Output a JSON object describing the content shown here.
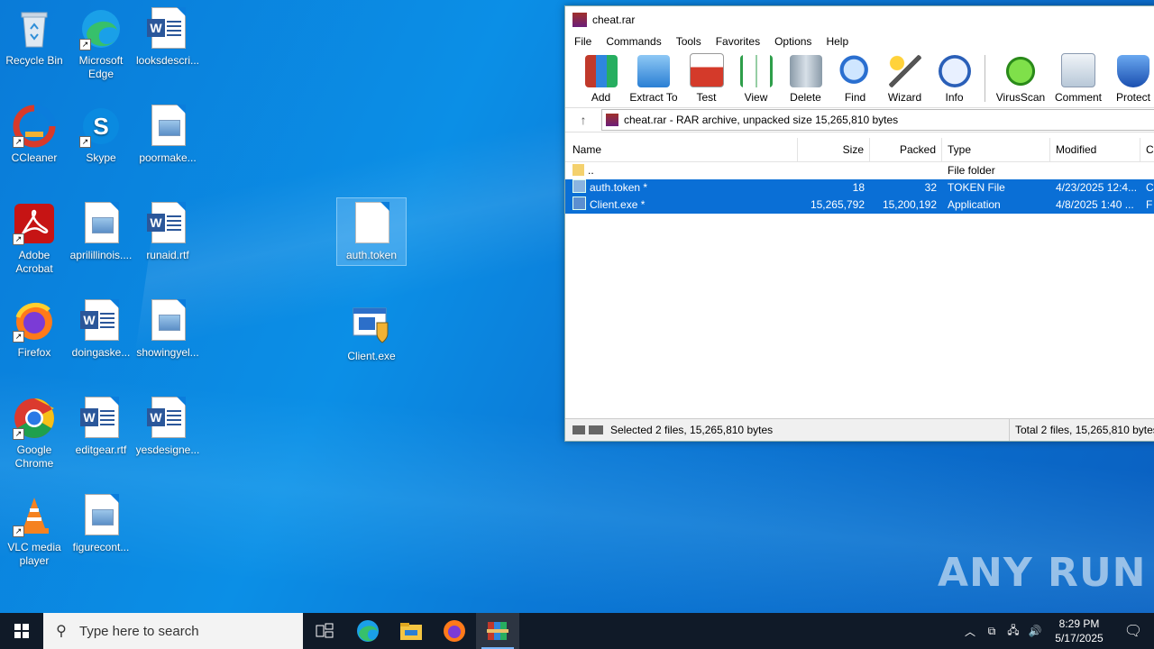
{
  "desktop": {
    "icons": [
      {
        "label": "Recycle Bin"
      },
      {
        "label": "Microsoft Edge"
      },
      {
        "label": "looksdescri..."
      },
      {
        "label": "CCleaner"
      },
      {
        "label": "Skype"
      },
      {
        "label": "poormake..."
      },
      {
        "label": "Adobe Acrobat"
      },
      {
        "label": "aprilillinois...."
      },
      {
        "label": "runaid.rtf"
      },
      {
        "label": "auth.token"
      },
      {
        "label": "Firefox"
      },
      {
        "label": "doingaske..."
      },
      {
        "label": "showingyel..."
      },
      {
        "label": "Client.exe"
      },
      {
        "label": "Google Chrome"
      },
      {
        "label": "editgear.rtf"
      },
      {
        "label": "yesdesigne..."
      },
      {
        "label": "VLC media player"
      },
      {
        "label": "figurecont..."
      }
    ]
  },
  "winrar": {
    "title": "cheat.rar",
    "menu": [
      "File",
      "Commands",
      "Tools",
      "Favorites",
      "Options",
      "Help"
    ],
    "toolbar": [
      "Add",
      "Extract To",
      "Test",
      "View",
      "Delete",
      "Find",
      "Wizard",
      "Info",
      "VirusScan",
      "Comment",
      "Protect"
    ],
    "address": "cheat.rar - RAR archive, unpacked size 15,265,810 bytes",
    "columns": {
      "name": "Name",
      "size": "Size",
      "packed": "Packed",
      "type": "Type",
      "modified": "Modified",
      "c": "C"
    },
    "rows": [
      {
        "name": "..",
        "size": "",
        "packed": "",
        "type": "File folder",
        "modified": "",
        "c": ""
      },
      {
        "name": "auth.token *",
        "size": "18",
        "packed": "32",
        "type": "TOKEN File",
        "modified": "4/23/2025 12:4...",
        "c": "C"
      },
      {
        "name": "Client.exe *",
        "size": "15,265,792",
        "packed": "15,200,192",
        "type": "Application",
        "modified": "4/8/2025 1:40 ...",
        "c": "F"
      }
    ],
    "status_left": "Selected 2 files, 15,265,810 bytes",
    "status_right": "Total 2 files, 15,265,810 bytes"
  },
  "watermark": "ANY RUN",
  "taskbar": {
    "search_placeholder": "Type here to search",
    "time": "8:29 PM",
    "date": "5/17/2025"
  }
}
